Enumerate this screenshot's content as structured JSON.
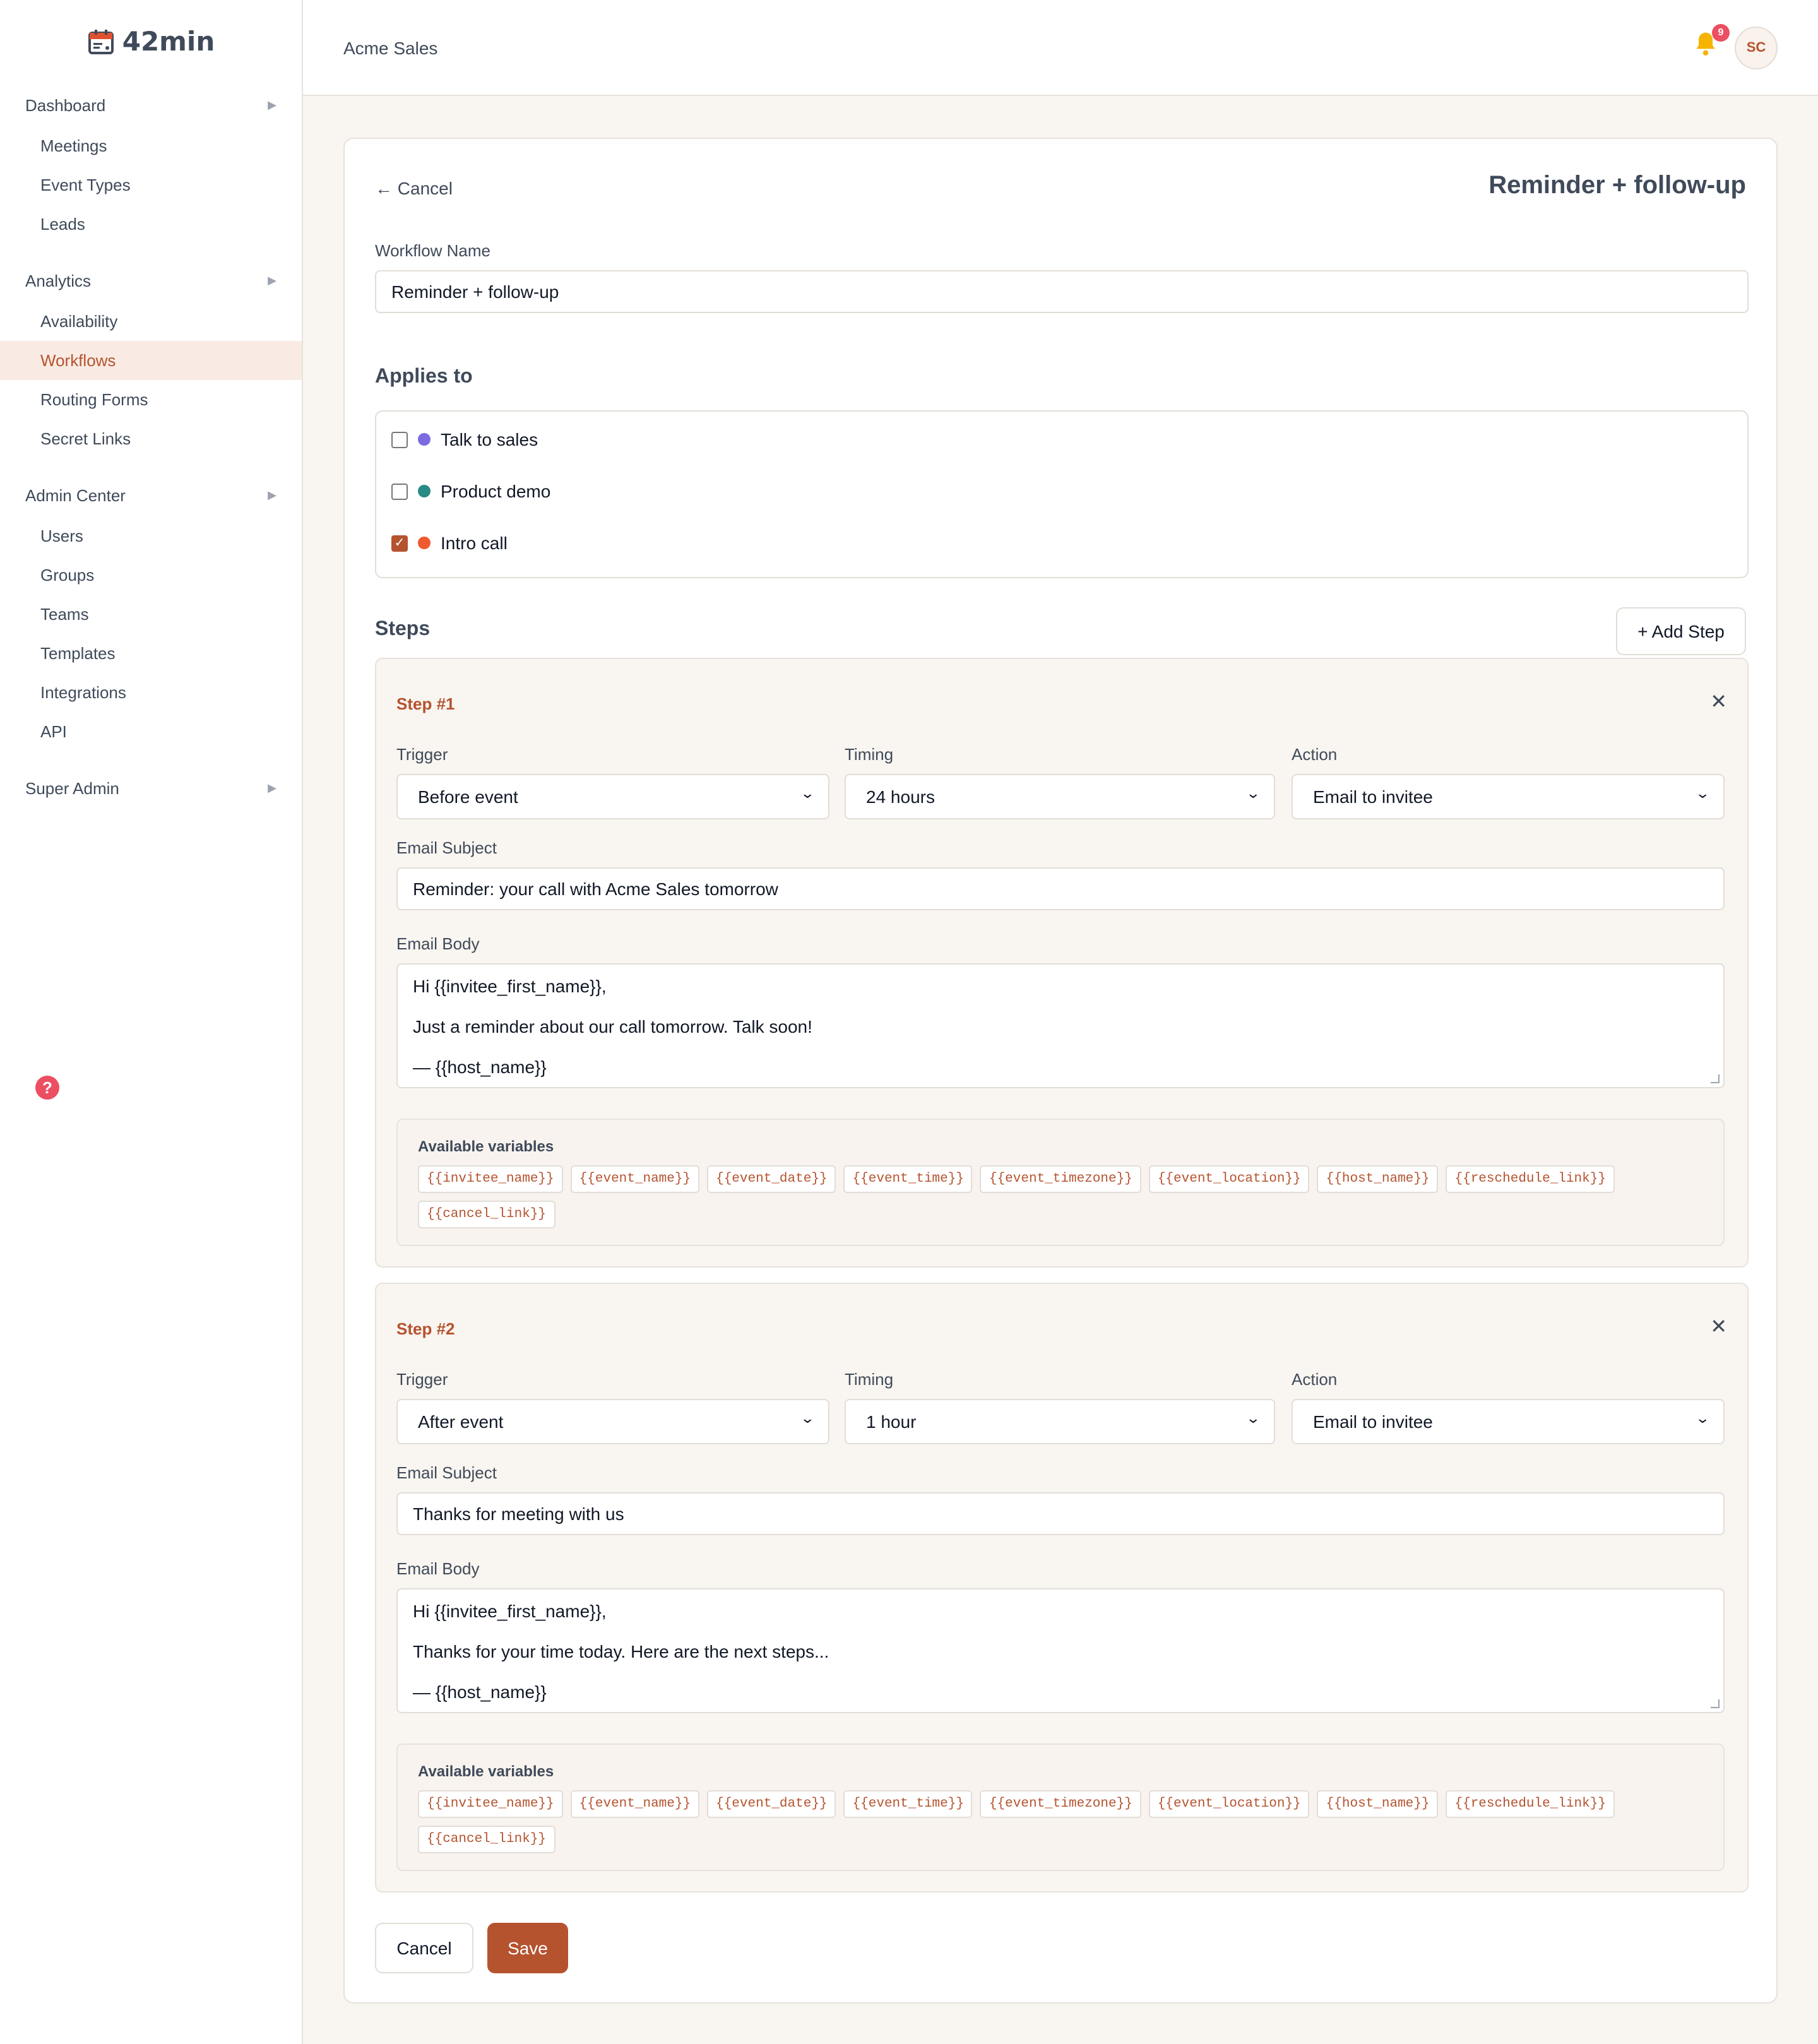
{
  "app": {
    "name": "42min"
  },
  "sidebar": {
    "groups": [
      {
        "label": "Dashboard",
        "items": [
          "Meetings",
          "Event Types",
          "Leads"
        ]
      },
      {
        "label": "Analytics",
        "items": [
          "Availability",
          "Workflows",
          "Routing Forms",
          "Secret Links"
        ]
      },
      {
        "label": "Admin Center",
        "items": [
          "Users",
          "Groups",
          "Teams",
          "Templates",
          "Integrations",
          "API"
        ]
      },
      {
        "label": "Super Admin",
        "items": []
      }
    ],
    "active_item": "Workflows"
  },
  "header": {
    "org_name": "Acme Sales",
    "notification_count": "9",
    "avatar_initials": "SC"
  },
  "page": {
    "cancel_label": "← Cancel",
    "title": "Reminder + follow-up",
    "workflow_name_label": "Workflow Name",
    "workflow_name_value": "Reminder + follow-up",
    "applies_to_title": "Applies to",
    "event_types": [
      {
        "label": "Talk to sales",
        "checked": false,
        "color": "#7b6be0"
      },
      {
        "label": "Product demo",
        "checked": false,
        "color": "#2a8a85"
      },
      {
        "label": "Intro call",
        "checked": true,
        "color": "#ef5a2e"
      }
    ],
    "steps_title": "Steps",
    "add_step_label": "+ Add Step",
    "steps": [
      {
        "title": "Step #1",
        "trigger_label": "Trigger",
        "trigger_value": "Before event",
        "timing_label": "Timing",
        "timing_value": "24 hours",
        "action_label": "Action",
        "action_value": "Email to invitee",
        "subject_label": "Email Subject",
        "subject_value": "Reminder: your call with Acme Sales tomorrow",
        "body_label": "Email Body",
        "body_lines": [
          "Hi {{invitee_first_name}},",
          "Just a reminder about our call tomorrow. Talk soon!",
          "— {{host_name}}"
        ],
        "variables_title": "Available variables"
      },
      {
        "title": "Step #2",
        "trigger_label": "Trigger",
        "trigger_value": "After event",
        "timing_label": "Timing",
        "timing_value": "1 hour",
        "action_label": "Action",
        "action_value": "Email to invitee",
        "subject_label": "Email Subject",
        "subject_value": "Thanks for meeting with us",
        "body_label": "Email Body",
        "body_lines": [
          "Hi {{invitee_first_name}},",
          "Thanks for your time today. Here are the next steps...",
          "— {{host_name}}"
        ],
        "variables_title": "Available variables"
      }
    ],
    "variables": [
      "{{invitee_name}}",
      "{{event_name}}",
      "{{event_date}}",
      "{{event_time}}",
      "{{event_timezone}}",
      "{{event_location}}",
      "{{host_name}}",
      "{{reschedule_link}}",
      "{{cancel_link}}"
    ],
    "cancel_button": "Cancel",
    "save_button": "Save"
  },
  "colors": {
    "accent": "#b5532f",
    "active_bg": "#f9ebe4",
    "page_bg": "#f9f5f0"
  }
}
